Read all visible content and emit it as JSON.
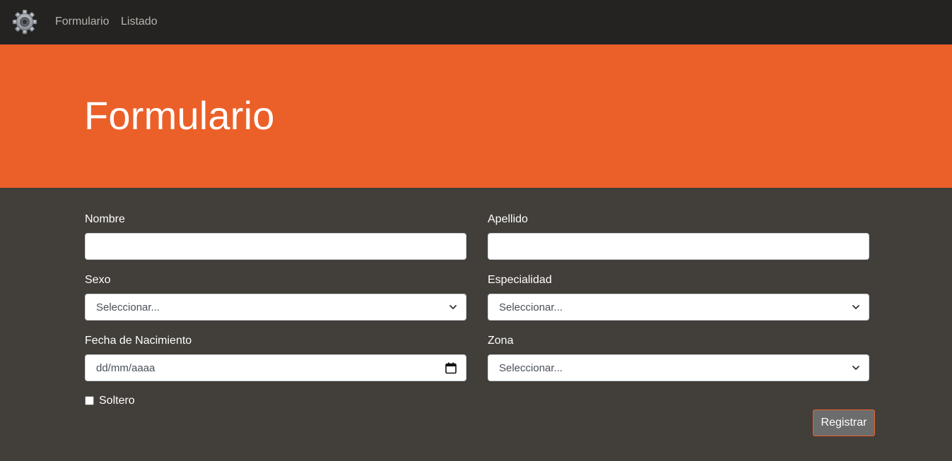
{
  "nav": {
    "logo_icon": "gear-icon",
    "links": [
      "Formulario",
      "Listado"
    ]
  },
  "hero": {
    "title": "Formulario",
    "background_color": "#eb6029"
  },
  "form": {
    "nombre": {
      "label": "Nombre",
      "value": ""
    },
    "apellido": {
      "label": "Apellido",
      "value": ""
    },
    "sexo": {
      "label": "Sexo",
      "selected": "Seleccionar..."
    },
    "especialidad": {
      "label": "Especialidad",
      "selected": "Seleccionar..."
    },
    "fecha": {
      "label": "Fecha de Nacimiento",
      "placeholder": "dd/mm/aaaa"
    },
    "zona": {
      "label": "Zona",
      "selected": "Seleccionar..."
    },
    "soltero": {
      "label": "Soltero",
      "checked": false
    },
    "submit_label": "Registrar"
  },
  "colors": {
    "navbar": "#242322",
    "accent": "#eb6029",
    "page_background": "#423e39",
    "button": "#6c6c6c"
  }
}
